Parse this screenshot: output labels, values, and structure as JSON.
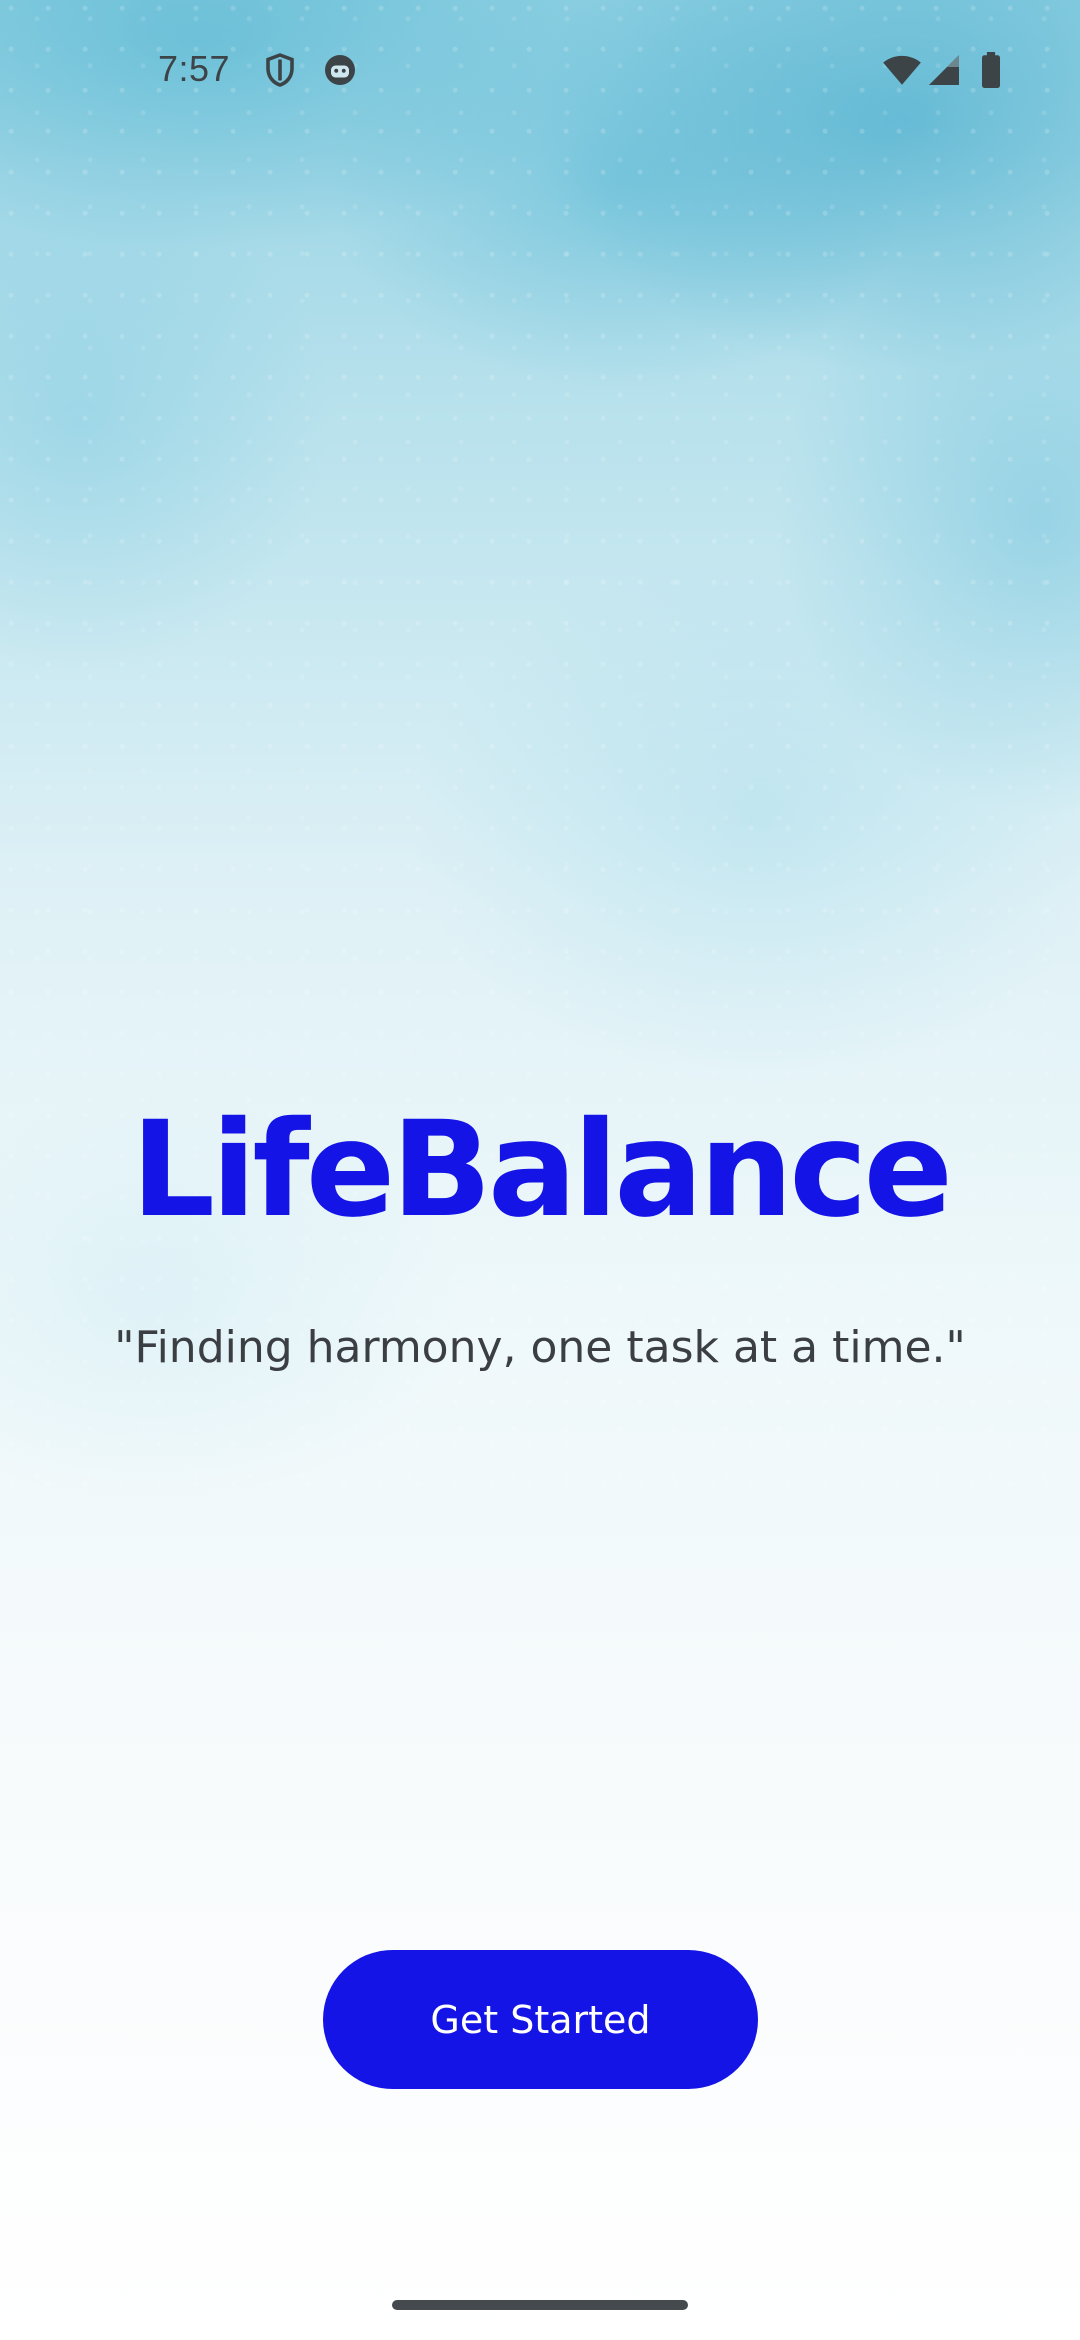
{
  "status_bar": {
    "time": "7:57",
    "left_icons": [
      "shield-icon",
      "android-face-icon"
    ],
    "right_icons": [
      "wifi-icon",
      "cellular-signal-icon",
      "battery-icon"
    ]
  },
  "app": {
    "title": "LifeBalance",
    "tagline": "\"Finding harmony, one task at a time.\"",
    "cta_label": "Get Started"
  },
  "colors": {
    "brand": "#1414e6",
    "tagline_text": "#3b3f44",
    "status_text": "#3d4448",
    "background_top": "#8fd0e2",
    "background_bottom": "#ffffff"
  }
}
